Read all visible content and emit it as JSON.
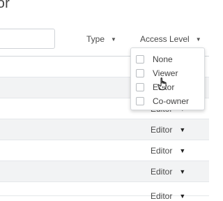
{
  "page": {
    "title": "tor"
  },
  "search": {
    "value": "",
    "placeholder": ""
  },
  "filters": {
    "type": {
      "label": "Type"
    },
    "access": {
      "label": "Access Level"
    }
  },
  "rows": [
    {
      "role": ""
    },
    {
      "role": ""
    },
    {
      "role": "Editor"
    },
    {
      "role": "Editor"
    },
    {
      "role": "Editor"
    },
    {
      "role": "Editor"
    },
    {
      "role": "Editor"
    }
  ],
  "dropdown": {
    "options": [
      {
        "label": "None",
        "checked": false
      },
      {
        "label": "Viewer",
        "checked": false
      },
      {
        "label": "Editor",
        "checked": false
      },
      {
        "label": "Co-owner",
        "checked": false
      }
    ]
  },
  "icons": {
    "caret": "caret-down-icon",
    "cursor": "hand-pointer-icon"
  },
  "colors": {
    "row_shade": "#f2f3f4",
    "border": "#d2d6da"
  }
}
